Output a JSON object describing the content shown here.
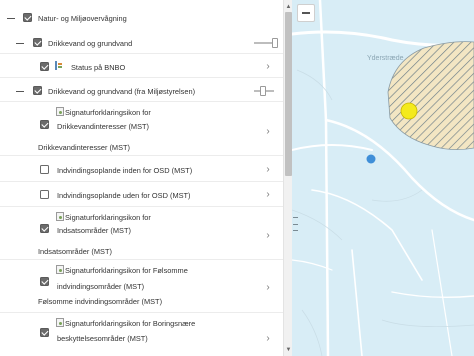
{
  "tree": {
    "root": {
      "label": "Natur- og Miljøovervågning",
      "checked": true
    },
    "group1": {
      "label": "Drikkevand og grundvand",
      "checked": true,
      "children": [
        {
          "label": "Status på BNBO",
          "checked": true
        }
      ]
    },
    "group2": {
      "label": "Drikkevand og grundvand (fra Miljøstyrelsen)",
      "checked": true,
      "children": [
        {
          "img_alt": "Signaturforklaringsikon for Drikkevandinteresser (MST)",
          "img_alt_line1": "Signaturforklaringsikon for",
          "img_alt_line2": "Drikkevandinteresser (MST)",
          "label": "Drikkevandinteresser (MST)",
          "checked": true
        },
        {
          "label": "Indvindingsoplande inden for OSD (MST)",
          "checked": false
        },
        {
          "label": "Indvindingsoplande uden for OSD (MST)",
          "checked": false
        },
        {
          "img_alt_line1": "Signaturforklaringsikon for",
          "img_alt_line2": "Indsatsområder (MST)",
          "label": "Indsatsområder (MST)",
          "checked": true
        },
        {
          "img_alt_line1": "Signaturforklaringsikon for Følsomme",
          "img_alt_line2": "indvindingsområder (MST)",
          "label": "Følsomme indvindingsområder (MST)",
          "checked": true
        },
        {
          "img_alt_line1": "Signaturforklaringsikon for Boringsnære",
          "img_alt_line2": "beskyttelsesområder (MST)",
          "label": "",
          "checked": true
        }
      ]
    }
  },
  "map": {
    "place_label": "Yderstræde",
    "colors": {
      "water": "#d8edf6",
      "hatch_fill": "#f3e6c3",
      "hatch_line": "#6d7f88",
      "marker_yellow": "#f4ea1c",
      "marker_blue": "#3f8fd8",
      "road": "#ffffff"
    }
  }
}
